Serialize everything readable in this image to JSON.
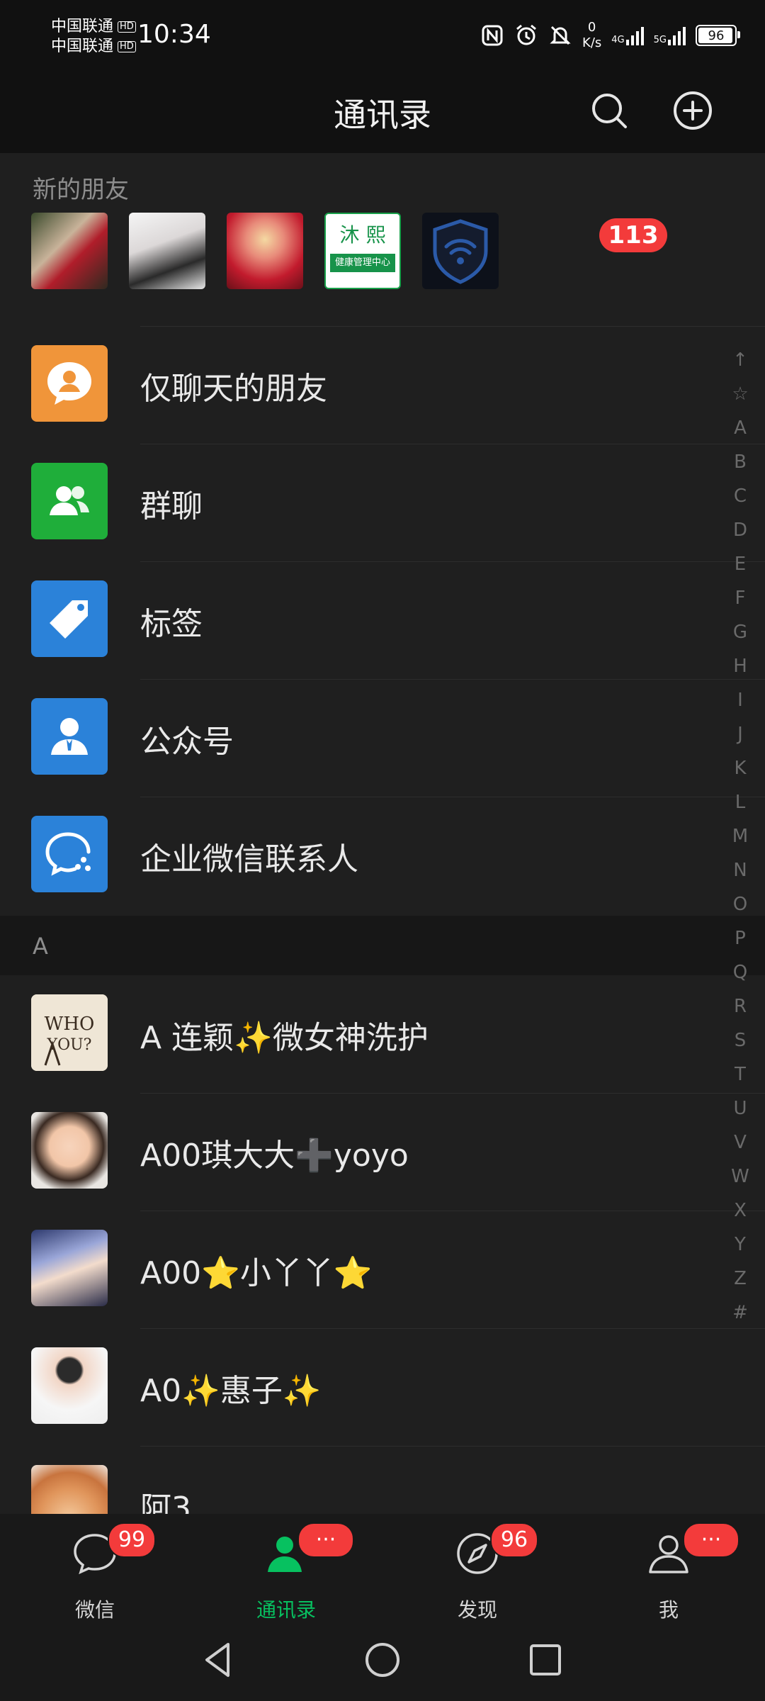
{
  "status_bar": {
    "carrier1": "中国联通",
    "carrier2": "中国联通",
    "hd1": "HD",
    "hd2": "HD",
    "time": "10:34",
    "net_speed_value": "0",
    "net_speed_unit": "K/s",
    "network1": "4G",
    "network2": "5G",
    "battery": "96",
    "battery_level": 0.96
  },
  "header": {
    "title": "通讯录",
    "search_icon": "search-icon",
    "add_icon": "plus-circle-icon"
  },
  "new_friends": {
    "label": "新的朋友",
    "badge": "113",
    "avatars": [
      {
        "name": "nails-photo"
      },
      {
        "name": "girl-photo"
      },
      {
        "name": "woman-red-photo"
      },
      {
        "name": "muxi-logo",
        "logo_text_top": "沐 熙",
        "logo_text_bottom": "健康管理中心"
      },
      {
        "name": "wifi-shield-logo"
      }
    ]
  },
  "menu": [
    {
      "label": "仅聊天的朋友",
      "icon": "chat-person-icon",
      "color": "#f0953a"
    },
    {
      "label": "群聊",
      "icon": "group-icon",
      "color": "#1fae3a"
    },
    {
      "label": "标签",
      "icon": "tag-icon",
      "color": "#2b82d9"
    },
    {
      "label": "公众号",
      "icon": "official-account-icon",
      "color": "#2b82d9"
    },
    {
      "label": "企业微信联系人",
      "icon": "wecom-icon",
      "color": "#2b82d9"
    }
  ],
  "section_a": "A",
  "contacts": [
    {
      "name": "A 连颖✨微女神洗护"
    },
    {
      "name": "A00琪大大➕yoyo"
    },
    {
      "name": "A00⭐小丫丫⭐"
    },
    {
      "name": "A0✨惠子✨"
    },
    {
      "name": "阿3"
    }
  ],
  "index_bar": [
    "↑",
    "☆",
    "A",
    "B",
    "C",
    "D",
    "E",
    "F",
    "G",
    "H",
    "I",
    "J",
    "K",
    "L",
    "M",
    "N",
    "O",
    "P",
    "Q",
    "R",
    "S",
    "T",
    "U",
    "V",
    "W",
    "X",
    "Y",
    "Z",
    "#"
  ],
  "bottom_nav": {
    "tabs": [
      {
        "label": "微信",
        "badge": "99",
        "icon": "chat-bubble-icon"
      },
      {
        "label": "通讯录",
        "badge": "···",
        "icon": "contacts-icon",
        "active": true
      },
      {
        "label": "发现",
        "badge": "96",
        "icon": "compass-icon"
      },
      {
        "label": "我",
        "badge": "···",
        "icon": "person-icon"
      }
    ],
    "active_color": "#07c160"
  }
}
